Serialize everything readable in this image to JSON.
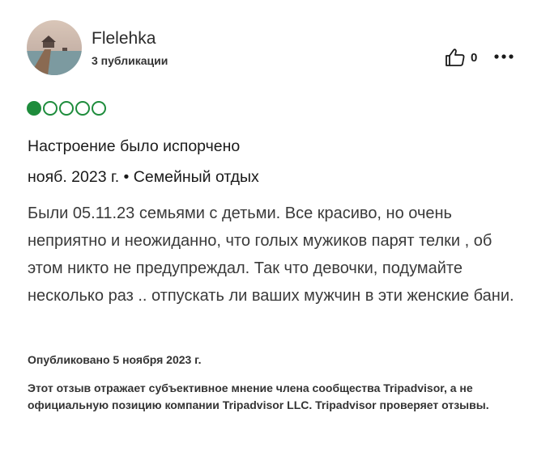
{
  "reviewer": {
    "name": "Flelehka",
    "contributions": "3 публикации"
  },
  "helpful": {
    "count": "0",
    "icon": "thumbs-up-icon"
  },
  "more_icon": "ellipsis-icon",
  "rating": {
    "value": 1,
    "max": 5,
    "color": "#1e8c3c"
  },
  "review": {
    "title": "Настроение было испорчено",
    "meta": "нояб. 2023 г. • Семейный отдых",
    "text": "Были 05.11.23 семьями с детьми. Все красиво, но очень неприятно и неожиданно, что голых мужиков парят телки , об этом никто не предупреждал. Так что девочки, подумайте несколько раз .. отпускать ли ваших мужчин в эти женские бани."
  },
  "published": "Опубликовано 5 ноября 2023 г.",
  "disclaimer": "Этот отзыв отражает субъективное мнение члена сообщества Tripadvisor, а не официальную позицию компании Tripadvisor LLC. Tripadvisor проверяет отзывы."
}
